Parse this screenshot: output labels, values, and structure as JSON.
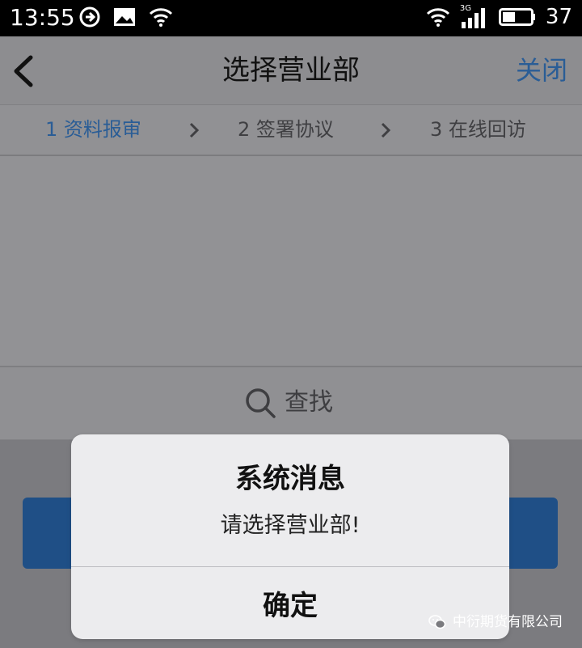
{
  "status_bar": {
    "time": "13:55",
    "battery": "37",
    "network_label": "3G",
    "icons_left": [
      "sync-icon",
      "image-notification-icon",
      "wifi-icon"
    ],
    "icons_right": [
      "wifi-icon",
      "cellular-signal-icon",
      "battery-icon"
    ]
  },
  "nav": {
    "title": "选择营业部",
    "close_label": "关闭",
    "back_icon": "back-chevron-icon"
  },
  "steps": [
    {
      "label": "1 资料报审",
      "active": true
    },
    {
      "label": "2 签署协议",
      "active": false
    },
    {
      "label": "3 在线回访",
      "active": false
    }
  ],
  "search": {
    "placeholder": "查找",
    "icon": "search-icon"
  },
  "dialog": {
    "title": "系统消息",
    "message": "请选择营业部!",
    "confirm_label": "确定"
  },
  "watermark": {
    "text": "中衍期货有限公司",
    "icon": "wechat-icon"
  },
  "colors": {
    "accent": "#2a5d96",
    "primary_button": "#1f4f86",
    "overlay_bg": "#7b7b7f",
    "dialog_bg": "#ececee"
  }
}
